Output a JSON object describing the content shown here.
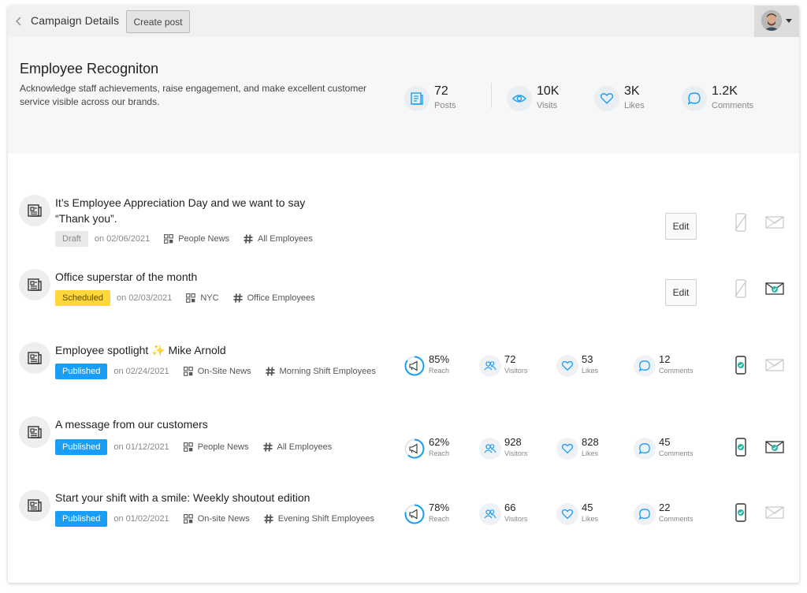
{
  "topbar": {
    "back_label": "Campaign Details",
    "create_post_label": "Create post"
  },
  "campaign": {
    "title": "Employee Recogniton",
    "description": "Acknowledge staff achievements, raise engagement, and make excellent customer service visible across our brands.",
    "stats": [
      {
        "value": "72",
        "label": "Posts",
        "icon": "posts-icon"
      },
      {
        "value": "10K",
        "label": "Visits",
        "icon": "eye-icon"
      },
      {
        "value": "3K",
        "label": "Likes",
        "icon": "heart-icon"
      },
      {
        "value": "1.2K",
        "label": "Comments",
        "icon": "comment-icon"
      }
    ]
  },
  "colors": {
    "accent_blue": "#1a9ef5",
    "scheduled_yellow": "#ffd63b",
    "active_teal": "#2bb5a0"
  },
  "edit_label": "Edit",
  "posts": [
    {
      "title": "It’s Employee Appreciation Day and we want to say “Thank you”.",
      "status": "Draft",
      "date": "on 02/06/2021",
      "channel_group": "People News",
      "audience": "All Employees",
      "mobile_active": false,
      "email_active": false
    },
    {
      "title": "Office superstar of the month",
      "status": "Scheduled",
      "date": "on 02/03/2021",
      "channel_group": "NYC",
      "audience": "Office Employees",
      "mobile_active": false,
      "email_active": true
    },
    {
      "title_prefix": "Employee spotlight",
      "title_suffix": "Mike Arnold",
      "status": "Published",
      "date": "on 02/24/2021",
      "channel_group": "On-Site News",
      "audience": "Morning Shift Employees",
      "reach": "85%",
      "reach_fraction": 0.85,
      "visitors": "72",
      "likes": "53",
      "comments": "12",
      "mobile_active": true,
      "email_active": false
    },
    {
      "title": "A message from our customers",
      "status": "Published",
      "date": "on 01/12/2021",
      "channel_group": "People News",
      "audience": "All Employees",
      "reach": "62%",
      "reach_fraction": 0.62,
      "visitors": "928",
      "likes": "828",
      "comments": "45",
      "mobile_active": true,
      "email_active": true
    },
    {
      "title": "Start your shift with a smile: Weekly shoutout edition",
      "status": "Published",
      "date": "on 01/02/2021",
      "channel_group": "On-site News",
      "audience": "Evening Shift Employees",
      "reach": "78%",
      "reach_fraction": 0.78,
      "visitors": "66",
      "likes": "45",
      "comments": "22",
      "mobile_active": true,
      "email_active": false
    }
  ],
  "metric_labels": {
    "reach": "Reach",
    "visitors": "Visitors",
    "likes": "Likes",
    "comments": "Comments"
  }
}
